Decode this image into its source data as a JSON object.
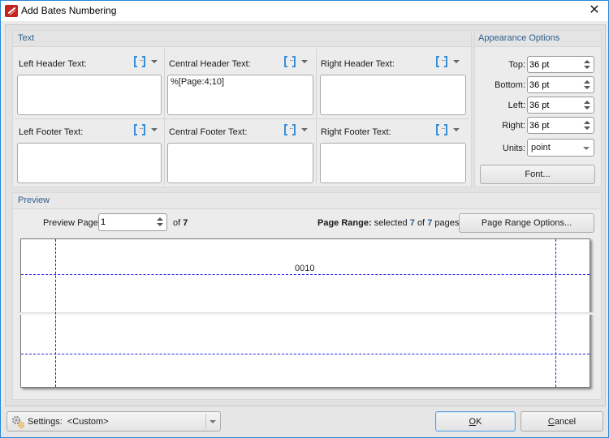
{
  "window": {
    "title": "Add Bates Numbering",
    "close_icon": "close-icon",
    "accent_color": "#2b87d3"
  },
  "text_group": {
    "title": "Text",
    "macro_icon": "insert-macro-icon",
    "fields": [
      {
        "label": "Left Header Text:",
        "value": ""
      },
      {
        "label": "Central Header Text:",
        "value": "%[Page:4;10]"
      },
      {
        "label": "Right Header Text:",
        "value": ""
      },
      {
        "label": "Left Footer Text:",
        "value": ""
      },
      {
        "label": "Central Footer Text:",
        "value": ""
      },
      {
        "label": "Right Footer Text:",
        "value": ""
      }
    ]
  },
  "appearance": {
    "title": "Appearance Options",
    "top_label": "Top:",
    "top_value": "36 pt",
    "bottom_label": "Bottom:",
    "bottom_value": "36 pt",
    "left_label": "Left:",
    "left_value": "36 pt",
    "right_label": "Right:",
    "right_value": "36 pt",
    "units_label": "Units:",
    "units_value": "point",
    "font_button": "Font..."
  },
  "preview": {
    "title": "Preview",
    "page_label": "Preview Page",
    "page_value": "1",
    "of_label": "of",
    "total_pages": "7",
    "range_label": "Page Range:",
    "range_selected_prefix": "selected",
    "range_selected": "7",
    "range_of": "of",
    "range_total": "7",
    "range_suffix": "pages",
    "range_button": "Page Range Options...",
    "stamp_text": "0010",
    "guide_color": "#2020e8"
  },
  "footer": {
    "settings_label": "Settings:",
    "settings_value": "<Custom>",
    "ok_accel": "O",
    "ok_rest": "K",
    "cancel_accel": "C",
    "cancel_rest": "ancel"
  }
}
